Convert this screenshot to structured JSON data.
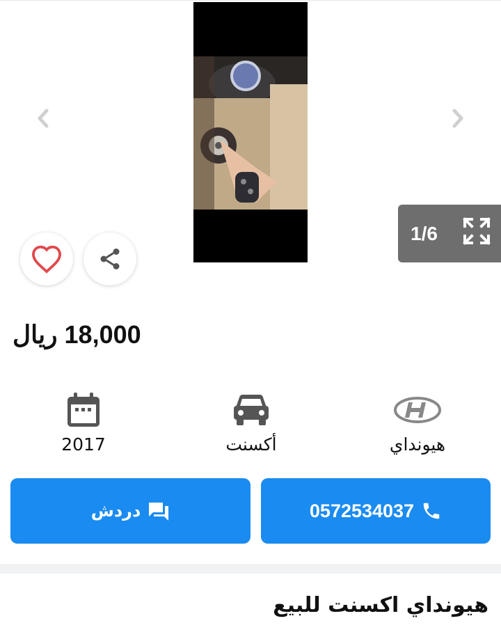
{
  "gallery": {
    "counter": "1/6",
    "icons": {
      "prev": "chevron-left-icon",
      "next": "chevron-right-icon",
      "expand": "expand-icon"
    }
  },
  "actions": {
    "favorite_icon": "heart-icon",
    "share_icon": "share-icon"
  },
  "listing": {
    "price": "18,000 ريال",
    "specs": {
      "year": "2017",
      "model": "أكسنت",
      "brand": "هيونداي"
    },
    "title": "هيونداي اكسنت للبيع"
  },
  "contact": {
    "chat_label": "دردش",
    "phone": "0572534037"
  },
  "colors": {
    "accent": "#1a8bf0",
    "heart": "#e2494d",
    "counter_bg": "#6e6e6e"
  }
}
